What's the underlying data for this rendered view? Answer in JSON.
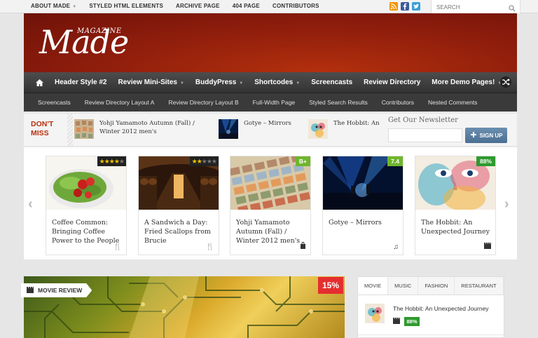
{
  "topbar": {
    "menu": [
      {
        "label": "ABOUT MADE",
        "has_caret": true
      },
      {
        "label": "STYLED HTML ELEMENTS",
        "has_caret": false
      },
      {
        "label": "ARCHIVE PAGE",
        "has_caret": false
      },
      {
        "label": "404 PAGE",
        "has_caret": false
      },
      {
        "label": "CONTRIBUTORS",
        "has_caret": false
      }
    ],
    "social": [
      "rss-icon",
      "facebook-icon",
      "twitter-icon"
    ],
    "search_placeholder": "SEARCH"
  },
  "header": {
    "logo_main": "Made",
    "logo_sub": "MAGAZINE",
    "bg_color": "#8e1d0c"
  },
  "main_nav": {
    "items": [
      {
        "label": "Header Style #2",
        "caret": false
      },
      {
        "label": "Review Mini-Sites",
        "caret": true
      },
      {
        "label": "BuddyPress",
        "caret": true
      },
      {
        "label": "Shortcodes",
        "caret": true
      },
      {
        "label": "Screencasts",
        "caret": false
      },
      {
        "label": "Review Directory",
        "caret": false
      },
      {
        "label": "More Demo Pages!",
        "caret": true
      }
    ]
  },
  "sub_nav": {
    "items": [
      "Screencasts",
      "Review Directory Layout A",
      "Review Directory Layout B",
      "Full-Width Page",
      "Styled Search Results",
      "Contributors",
      "Nested Comments"
    ]
  },
  "dont_miss": {
    "label_line1": "DON'T",
    "label_line2": "MISS",
    "items": [
      {
        "line1": "Yohji Yamamoto Autumn (Fall) /",
        "line2": "Winter 2012 men's"
      },
      {
        "line1": "Gotye – Mirrors",
        "line2": ""
      },
      {
        "line1": "The Hobbit: An",
        "line2": ""
      }
    ],
    "newsletter_title": "Get Our Newsletter",
    "signup_label": "SIGN UP"
  },
  "slider": {
    "cards": [
      {
        "title": "Coffee Common: Bringing Coffee Power to the People",
        "rating_stars": 4,
        "badge": "",
        "category_icon": "restaurant-icon"
      },
      {
        "title": "A Sandwich a Day: Fried Scallops from Brucie",
        "rating_stars": 2,
        "badge": "",
        "category_icon": "restaurant-icon"
      },
      {
        "title": "Yohji Yamamoto Autumn (Fall) / Winter 2012 men's",
        "rating_stars": 0,
        "badge": "B+",
        "category_icon": "shopping-bag-icon"
      },
      {
        "title": "Gotye – Mirrors",
        "rating_stars": 0,
        "badge": "7.4",
        "category_icon": "music-note-icon"
      },
      {
        "title": "The Hobbit: An Unexpected Journey",
        "rating_stars": 0,
        "badge": "88%",
        "category_icon": "film-icon"
      }
    ]
  },
  "feature": {
    "tag": "MOVIE REVIEW",
    "score": "15%",
    "score_color": "#e52e2e"
  },
  "side_tabs": {
    "tabs": [
      "MOVIE",
      "MUSIC",
      "FASHION",
      "RESTAURANT"
    ],
    "active": "MOVIE",
    "item": {
      "title": "The Hobbit: An Unexpected Journey",
      "score": "88%"
    }
  }
}
